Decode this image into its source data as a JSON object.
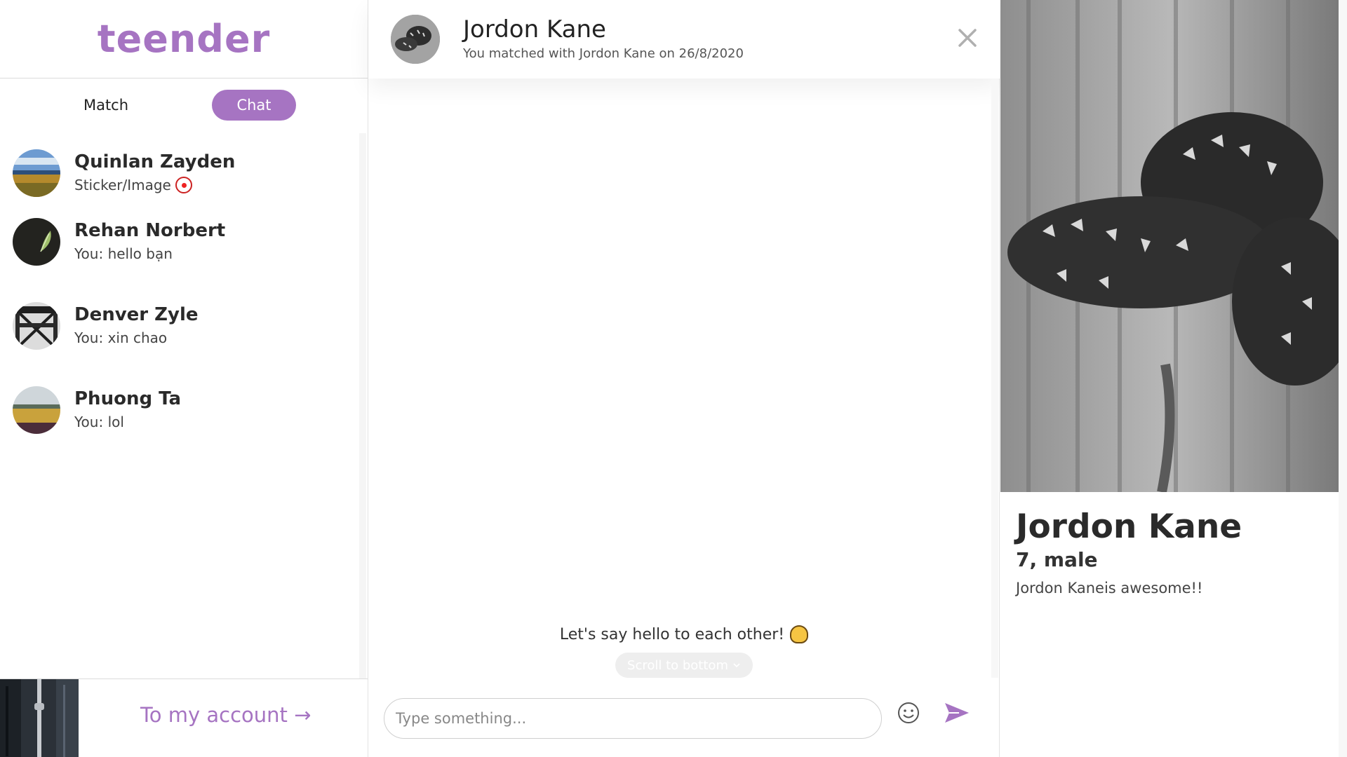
{
  "brand": {
    "logo_text": "teender",
    "accent_color": "#a674c2"
  },
  "tabs": [
    {
      "label": "Match",
      "active": false
    },
    {
      "label": "Chat",
      "active": true
    }
  ],
  "conversations": [
    {
      "name": "Quinlan Zayden",
      "preview": "Sticker/Image",
      "preview_icon": "clown-emoji-icon"
    },
    {
      "name": "Rehan Norbert",
      "preview": "You: hello bạn"
    },
    {
      "name": "Denver Zyle",
      "preview": "You: xin chao"
    },
    {
      "name": "Phuong Ta",
      "preview": "You: lol"
    }
  ],
  "account": {
    "link_label": "To my account",
    "arrow": "→"
  },
  "chat": {
    "title": "Jordon Kane",
    "subtitle": "You matched with Jordon Kane on 26/8/2020",
    "empty_message": "Let's say hello to each other!",
    "empty_icon": "waving-hand-emoji-icon",
    "scroll_to_bottom_label": "Scroll to bottom",
    "composer_placeholder": "Type something...",
    "composer_value": ""
  },
  "profile": {
    "name": "Jordon Kane",
    "meta": "7, male",
    "bio": "Jordon Kaneis awesome!!"
  }
}
